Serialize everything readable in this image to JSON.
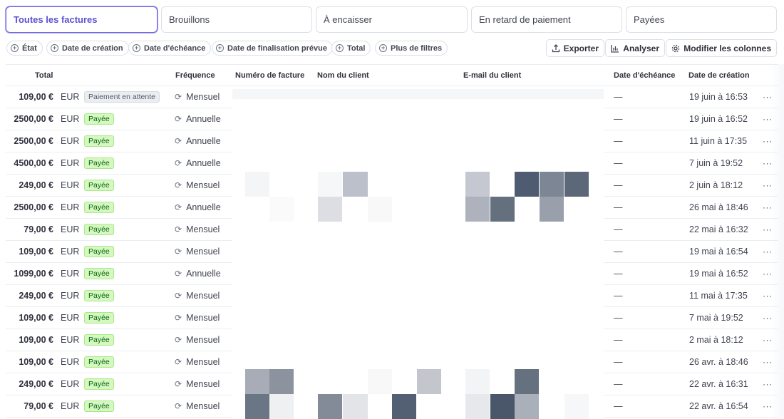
{
  "tabs": [
    {
      "label": "Toutes les factures",
      "active": true
    },
    {
      "label": "Brouillons",
      "active": false
    },
    {
      "label": "À encaisser",
      "active": false
    },
    {
      "label": "En retard de paiement",
      "active": false
    },
    {
      "label": "Payées",
      "active": false
    }
  ],
  "filters": [
    {
      "label": "État"
    },
    {
      "label": "Date de création"
    },
    {
      "label": "Date d'échéance"
    },
    {
      "label": "Date de finalisation prévue"
    },
    {
      "label": "Total"
    },
    {
      "label": "Plus de filtres"
    }
  ],
  "actions": {
    "export_label": "Exporter",
    "analyze_label": "Analyser",
    "columns_label": "Modifier les colonnes"
  },
  "table": {
    "headers": {
      "total": "Total",
      "frequency": "Fréquence",
      "invoice_number": "Numéro de facture",
      "customer_name": "Nom du client",
      "customer_email": "E-mail du client",
      "due_date": "Date d'échéance",
      "created_date": "Date de création"
    },
    "rows": [
      {
        "amount": "109,00 €",
        "currency": "EUR",
        "status": "Paiement en attente",
        "status_type": "pending",
        "frequency": "Mensuel",
        "due": "—",
        "created": "19 juin à 16:53",
        "more": "···"
      },
      {
        "amount": "2500,00 €",
        "currency": "EUR",
        "status": "Payée",
        "status_type": "paid",
        "frequency": "Annuelle",
        "due": "—",
        "created": "19 juin à 16:52",
        "more": "···"
      },
      {
        "amount": "2500,00 €",
        "currency": "EUR",
        "status": "Payée",
        "status_type": "paid",
        "frequency": "Annuelle",
        "due": "—",
        "created": "11 juin à 17:35",
        "more": "···"
      },
      {
        "amount": "4500,00 €",
        "currency": "EUR",
        "status": "Payée",
        "status_type": "paid",
        "frequency": "Annuelle",
        "due": "—",
        "created": "7 juin à 19:52",
        "more": "···"
      },
      {
        "amount": "249,00 €",
        "currency": "EUR",
        "status": "Payée",
        "status_type": "paid",
        "frequency": "Mensuel",
        "due": "—",
        "created": "2 juin à 18:12",
        "more": "···"
      },
      {
        "amount": "2500,00 €",
        "currency": "EUR",
        "status": "Payée",
        "status_type": "paid",
        "frequency": "Annuelle",
        "due": "—",
        "created": "26 mai à 18:46",
        "more": "···"
      },
      {
        "amount": "79,00 €",
        "currency": "EUR",
        "status": "Payée",
        "status_type": "paid",
        "frequency": "Mensuel",
        "due": "—",
        "created": "22 mai à 16:32",
        "more": "···"
      },
      {
        "amount": "109,00 €",
        "currency": "EUR",
        "status": "Payée",
        "status_type": "paid",
        "frequency": "Mensuel",
        "due": "—",
        "created": "19 mai à 16:54",
        "more": "···"
      },
      {
        "amount": "1099,00 €",
        "currency": "EUR",
        "status": "Payée",
        "status_type": "paid",
        "frequency": "Annuelle",
        "due": "—",
        "created": "19 mai à 16:52",
        "more": "···"
      },
      {
        "amount": "249,00 €",
        "currency": "EUR",
        "status": "Payée",
        "status_type": "paid",
        "frequency": "Mensuel",
        "due": "—",
        "created": "11 mai à 17:35",
        "more": "···"
      },
      {
        "amount": "109,00 €",
        "currency": "EUR",
        "status": "Payée",
        "status_type": "paid",
        "frequency": "Mensuel",
        "due": "—",
        "created": "7 mai à 19:52",
        "more": "···"
      },
      {
        "amount": "109,00 €",
        "currency": "EUR",
        "status": "Payée",
        "status_type": "paid",
        "frequency": "Mensuel",
        "due": "—",
        "created": "2 mai à 18:12",
        "more": "···"
      },
      {
        "amount": "109,00 €",
        "currency": "EUR",
        "status": "Payée",
        "status_type": "paid",
        "frequency": "Mensuel",
        "due": "—",
        "created": "26 avr. à 18:46",
        "more": "···"
      },
      {
        "amount": "249,00 €",
        "currency": "EUR",
        "status": "Payée",
        "status_type": "paid",
        "frequency": "Mensuel",
        "due": "—",
        "created": "22 avr. à 16:31",
        "more": "···"
      },
      {
        "amount": "79,00 €",
        "currency": "EUR",
        "status": "Payée",
        "status_type": "paid",
        "frequency": "Mensuel",
        "due": "—",
        "created": "22 avr. à 16:54",
        "more": "···"
      }
    ]
  },
  "icons": {
    "filter_add": "plus-circle-icon",
    "export": "export-icon",
    "analyze": "bar-chart-icon",
    "columns": "gear-icon",
    "frequency": "recurring-icon",
    "more": "more-icon"
  },
  "colors": {
    "accent": "#635bff",
    "paid_bg": "#d7f7c2",
    "paid_text": "#05690d",
    "pending_bg": "#ebeef1",
    "redaction_dark": "#4e5b70"
  }
}
